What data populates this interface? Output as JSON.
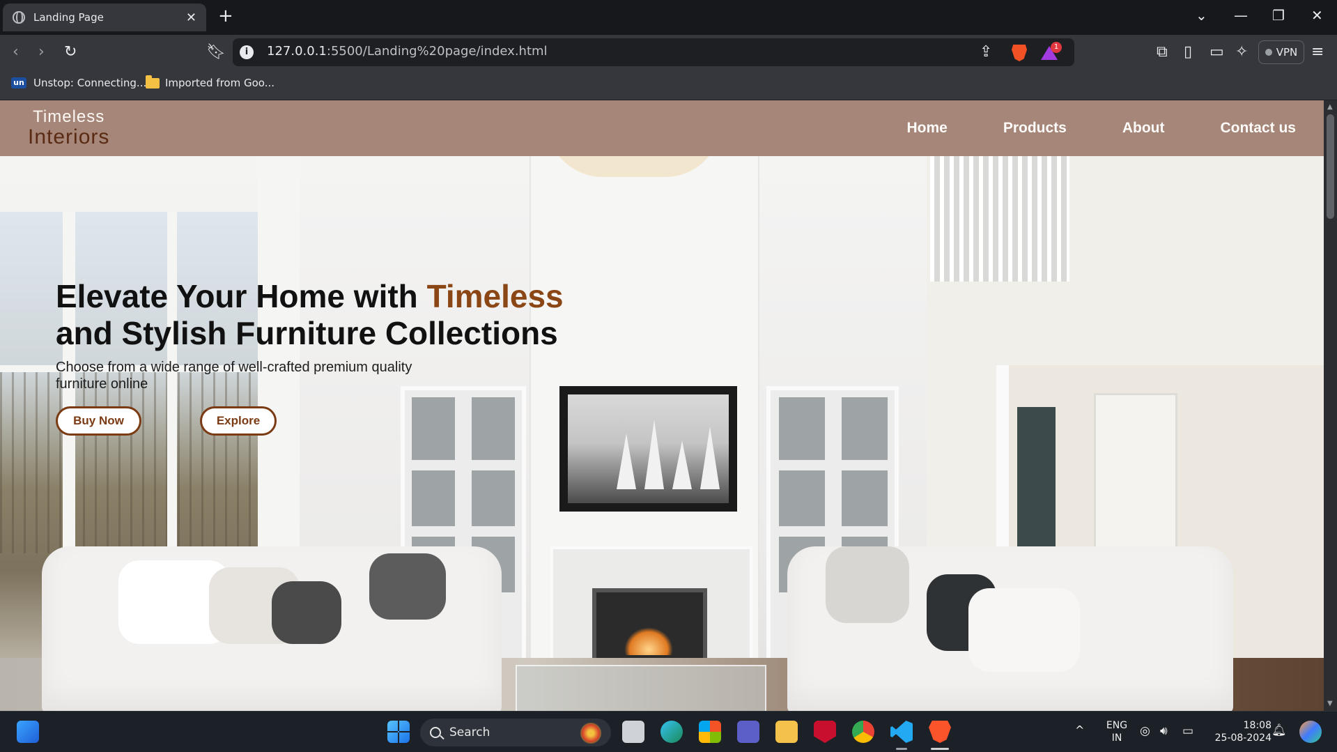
{
  "browser": {
    "tab_title": "Landing Page",
    "tab_close": "✕",
    "new_tab": "+",
    "url_host": "127.0.0.1",
    "url_rest": ":5500/Landing%20page/index.html",
    "extension_badge": "1",
    "vpn_label": "VPN",
    "bookmarks": [
      {
        "label": "Unstop: Connecting...",
        "icon": "un"
      },
      {
        "label": "Imported from Goo...",
        "icon": "folder-icon"
      }
    ]
  },
  "site": {
    "logo_line1": "Timeless",
    "logo_line2": "Interiors",
    "nav": [
      "Home",
      "Products",
      "About",
      "Contact us"
    ],
    "hero": {
      "title_part1": "Elevate Your Home with ",
      "title_accent": "Timeless",
      "title_part2": "and Stylish Furniture Collections",
      "subtitle": "Choose from a wide range of well-crafted premium quality furniture online",
      "buy_label": "Buy Now",
      "explore_label": "Explore"
    },
    "colors": {
      "nav_bg": "#a58678",
      "accent": "#8b4616",
      "button_border": "#7a3a14"
    }
  },
  "taskbar": {
    "search_placeholder": "Search",
    "lang_line1": "ENG",
    "lang_line2": "IN",
    "time": "18:08",
    "date": "25-08-2024"
  }
}
